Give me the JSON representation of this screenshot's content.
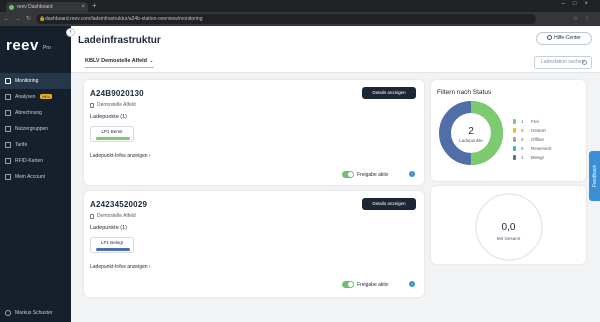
{
  "browser": {
    "tab_title": "reev Dashboard",
    "url": "dashboard.reev.com/ladeinfrastruktur/a24b-station-overview/monitoring"
  },
  "sidebar": {
    "logo": "reev",
    "logo_sub": "Pro",
    "items": [
      {
        "label": "Monitoring",
        "active": true
      },
      {
        "label": "Analysen",
        "badge": "NEU"
      },
      {
        "label": "Abrechnung"
      },
      {
        "label": "Nutzergruppen"
      },
      {
        "label": "Tarife"
      },
      {
        "label": "RFID-Karten"
      },
      {
        "label": "Mein Account"
      }
    ],
    "user": "Markus Schuster"
  },
  "header": {
    "title": "Ladeinfrastruktur",
    "help_label": "Hilfe-Center",
    "location_tab": "KBLV Demostelle Alfeld",
    "search_placeholder": "Ladestation suchen"
  },
  "stations": [
    {
      "id": "A24B9020130",
      "name": "Demostelle Alfeld",
      "details_button": "Details anzeigen",
      "ladepunkte_label": "Ladepunkte (1)",
      "chip_label": "LP1 Bereit",
      "chip_color": "#7ccb6f",
      "link_label": "Ladepunkt-Infos anzeigen",
      "toggle_label": "Freigabe aktiv"
    },
    {
      "id": "A24234520029",
      "name": "Demostelle Alfeld",
      "details_button": "Details anzeigen",
      "ladepunkte_label": "Ladepunkte (1)",
      "chip_label": "LP1 Belegt",
      "chip_color": "#4f6fa6",
      "link_label": "Ladepunkt-Infos anzeigen",
      "toggle_label": "Freigabe aktiv"
    }
  ],
  "filter": {
    "title": "Filtern nach Status",
    "donut_value": "2",
    "donut_label": "Ladepunkte",
    "legend": [
      {
        "count": "1",
        "label": "Frei",
        "color": "#7ccb6f"
      },
      {
        "count": "0",
        "label": "Gestört",
        "color": "#f0b632"
      },
      {
        "count": "0",
        "label": "Offline",
        "color": "#9aa3ad"
      },
      {
        "count": "0",
        "label": "Reserviert",
        "color": "#3ab6c5"
      },
      {
        "count": "1",
        "label": "Belegt",
        "color": "#4f6fa6"
      }
    ]
  },
  "gauge": {
    "value": "0,0",
    "label": "kW Gesamt"
  },
  "feedback_label": "Feedback"
}
